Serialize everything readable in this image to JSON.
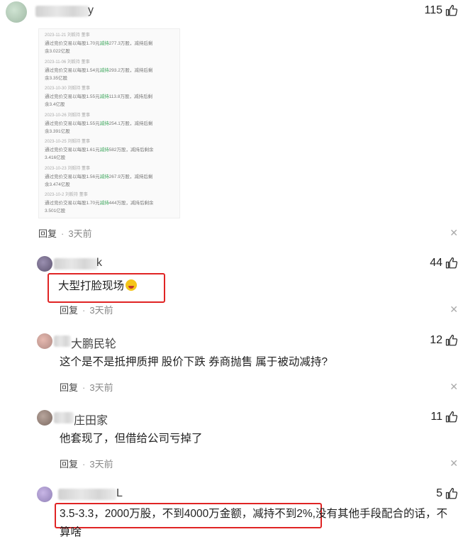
{
  "comments": [
    {
      "name_tail": "y",
      "likes": "115",
      "reply_label": "回复",
      "time": "3天前",
      "image_entries": [
        {
          "date": "2023-11-21 刘毅持 董事",
          "l1_a": "通过竞价交易以每股1.70元",
          "l1_g": "减持",
          "l1_b": "277.3万股，减持后剩",
          "l2": "余3.022亿股"
        },
        {
          "date": "2023-11-06 刘毅持 董事",
          "l1_a": "通过竞价交易以每股1.54元",
          "l1_g": "减持",
          "l1_b": "293.2万股，减持后剩",
          "l2": "余3.35亿股"
        },
        {
          "date": "2023-10-30 刘毅持 董事",
          "l1_a": "通过竞价交易以每股1.55元",
          "l1_g": "减持",
          "l1_b": "113.8万股，减持后剩",
          "l2": "余3.4亿股"
        },
        {
          "date": "2023-10-26 刘毅持 董事",
          "l1_a": "通过竞价交易以每股1.55元",
          "l1_g": "减持",
          "l1_b": "254.1万股，减持后剩",
          "l2": "余3.391亿股"
        },
        {
          "date": "2023-10-25 刘毅持 董事",
          "l1_a": "通过竞价交易以每股1.61元",
          "l1_g": "减持",
          "l1_b": "582万股，减持后剩余",
          "l2": "3.416亿股"
        },
        {
          "date": "2023-10-23 刘毅持 董事",
          "l1_a": "通过竞价交易以每股1.56元",
          "l1_g": "减持",
          "l1_b": "267.9万股，减持后剩",
          "l2": "余3.474亿股"
        },
        {
          "date": "2023-10-2 刘毅持 董事",
          "l1_a": "通过竞价交易以每股1.70元",
          "l1_g": "减持",
          "l1_b": "444万股，减持后剩余",
          "l2": "3.501亿股"
        }
      ]
    },
    {
      "name_tail": "k",
      "likes": "44",
      "text": "大型打脸现场",
      "reply_label": "回复",
      "time": "3天前"
    },
    {
      "name_tail": "大鹏民轮",
      "likes": "12",
      "text": "这个是不是抵押质押 股价下跌 券商抛售 属于被动减持?",
      "reply_label": "回复",
      "time": "3天前"
    },
    {
      "name_tail": "庄田家",
      "likes": "11",
      "text": "他套现了，但借给公司亏掉了",
      "reply_label": "回复",
      "time": "3天前"
    },
    {
      "name_tail": "L",
      "likes": "5",
      "text_boxed": "3.5-3.3，2000万股，不到4000万金额，减持不到2%,",
      "text_rest": "没有其他手段配合的话，不",
      "text_line2": "算啥"
    }
  ],
  "colors": {
    "highlight": "#e02424",
    "green": "#3aa55a"
  },
  "icons": {
    "like": "thumbs-up-icon",
    "close": "close-icon"
  }
}
